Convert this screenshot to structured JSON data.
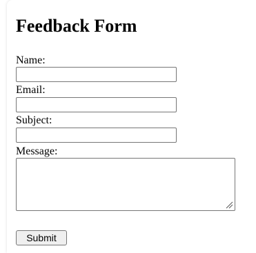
{
  "form": {
    "title": "Feedback Form",
    "fields": {
      "name": {
        "label": "Name:",
        "value": "",
        "placeholder": ""
      },
      "email": {
        "label": "Email:",
        "value": "",
        "placeholder": ""
      },
      "subject": {
        "label": "Subject:",
        "value": "",
        "placeholder": ""
      },
      "message": {
        "label": "Message:",
        "value": "",
        "placeholder": ""
      }
    },
    "submit_label": "Submit"
  }
}
